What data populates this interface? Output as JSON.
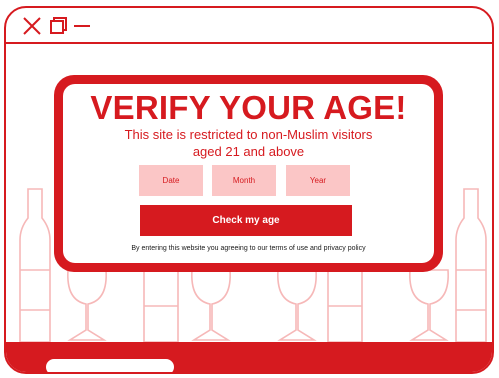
{
  "window": {
    "controls": [
      "close-icon",
      "maximize-icon",
      "minimize-icon"
    ]
  },
  "modal": {
    "title": "VERIFY YOUR AGE!",
    "subtitle_line1": "This site is restricted to non-Muslim visitors",
    "subtitle_line2": "aged 21 and above",
    "fields": {
      "date_placeholder": "Date",
      "month_placeholder": "Month",
      "year_placeholder": "Year"
    },
    "check_button": "Check my age",
    "disclaimer": "By entering this website you agreeing to our terms of use and privacy policy"
  },
  "colors": {
    "accent": "#d61a1f",
    "field_bg": "#fbc6c6",
    "illustration": "#f6b8b8"
  },
  "decor_icons": [
    "wine-bottle-icon",
    "wine-glass-icon"
  ]
}
